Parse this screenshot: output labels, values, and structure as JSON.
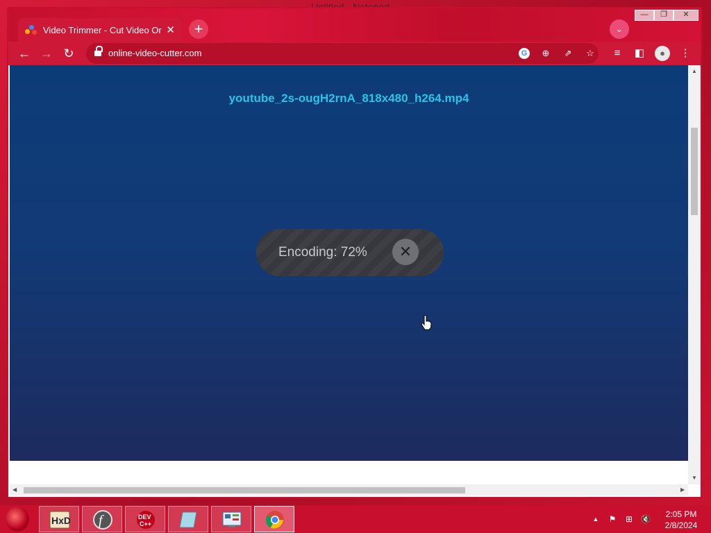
{
  "background": {
    "window_title": "Untitled - Notepad"
  },
  "browser": {
    "tab": {
      "title": "Video Trimmer - Cut Video Onlin",
      "close": "✕"
    },
    "new_tab": "+",
    "tab_search": "⌄",
    "window_buttons": {
      "minimize": "—",
      "maximize": "❐",
      "close": "✕"
    },
    "nav": {
      "back": "←",
      "forward": "→",
      "reload": "↻"
    },
    "address": {
      "url": "online-video-cutter.com"
    },
    "omnibox_icons": {
      "google": "G",
      "zoom": "⊕",
      "share": "⇗",
      "bookmark": "☆"
    },
    "toolbar_icons": {
      "media": "≡",
      "sidepanel": "◧",
      "profile": "●",
      "menu": "⋮"
    }
  },
  "page": {
    "filename": "youtube_2s-ougH2rnA_818x480_h264.mp4",
    "encoding": {
      "label": "Encoding: 72%",
      "progress_percent": 72,
      "cancel": "✕"
    }
  },
  "taskbar": {
    "apps": [
      {
        "name": "hxd",
        "label": "HxD"
      },
      {
        "name": "flash",
        "label": "f"
      },
      {
        "name": "devcpp",
        "label": "DEV C++"
      },
      {
        "name": "notepad",
        "label": ""
      },
      {
        "name": "control-panel",
        "label": ""
      },
      {
        "name": "chrome",
        "label": ""
      }
    ],
    "tray": {
      "show_hidden": "▲",
      "flag": "⚑",
      "network": "⊞",
      "volume": "🔇"
    },
    "clock": {
      "time": "2:05 PM",
      "date": "2/8/2024"
    }
  },
  "colors": {
    "accent": "#c8102e",
    "page_bg_top": "#0c3c78",
    "page_bg_bottom": "#1d2b5e",
    "filename": "#27c4e8",
    "overlay": "#3d3f45"
  }
}
